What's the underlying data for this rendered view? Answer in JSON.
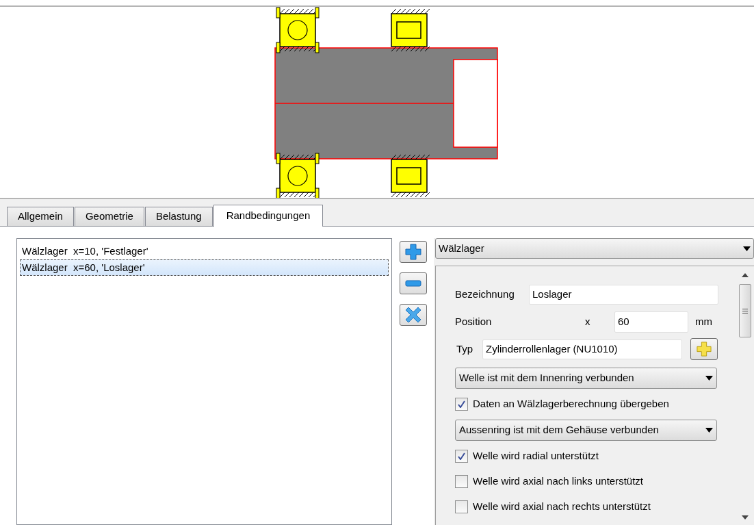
{
  "tabs": [
    {
      "label": "Allgemein",
      "selected": false
    },
    {
      "label": "Geometrie",
      "selected": false
    },
    {
      "label": "Belastung",
      "selected": false
    },
    {
      "label": "Randbedingungen",
      "selected": true
    }
  ],
  "support_list": [
    {
      "label": "Wälzlager  x=10, 'Festlager'",
      "selected": false
    },
    {
      "label": "Wälzlager  x=60, 'Loslager'",
      "selected": true
    }
  ],
  "support_type": {
    "value": "Wälzlager"
  },
  "details": {
    "name_label": "Bezeichnung",
    "name_value": "Loslager",
    "position_label": "Position",
    "axis": "x",
    "position_value": "60",
    "unit": "mm",
    "type_label": "Typ",
    "type_value": "Zylinderrollenlager (NU1010)"
  },
  "options": [
    {
      "kind": "dropdown",
      "value": "Welle ist mit dem Innenring verbunden"
    },
    {
      "kind": "checkbox",
      "label": "Daten an Wälzlagerberechnung übergeben",
      "checked": true
    },
    {
      "kind": "dropdown",
      "value": "Aussenring ist mit dem Gehäuse verbunden"
    },
    {
      "kind": "checkbox",
      "label": "Welle wird radial unterstützt",
      "checked": true
    },
    {
      "kind": "checkbox",
      "label": "Welle wird axial nach links unterstützt",
      "checked": false
    },
    {
      "kind": "checkbox",
      "label": "Welle wird axial nach rechts unterstützt",
      "checked": false
    }
  ]
}
